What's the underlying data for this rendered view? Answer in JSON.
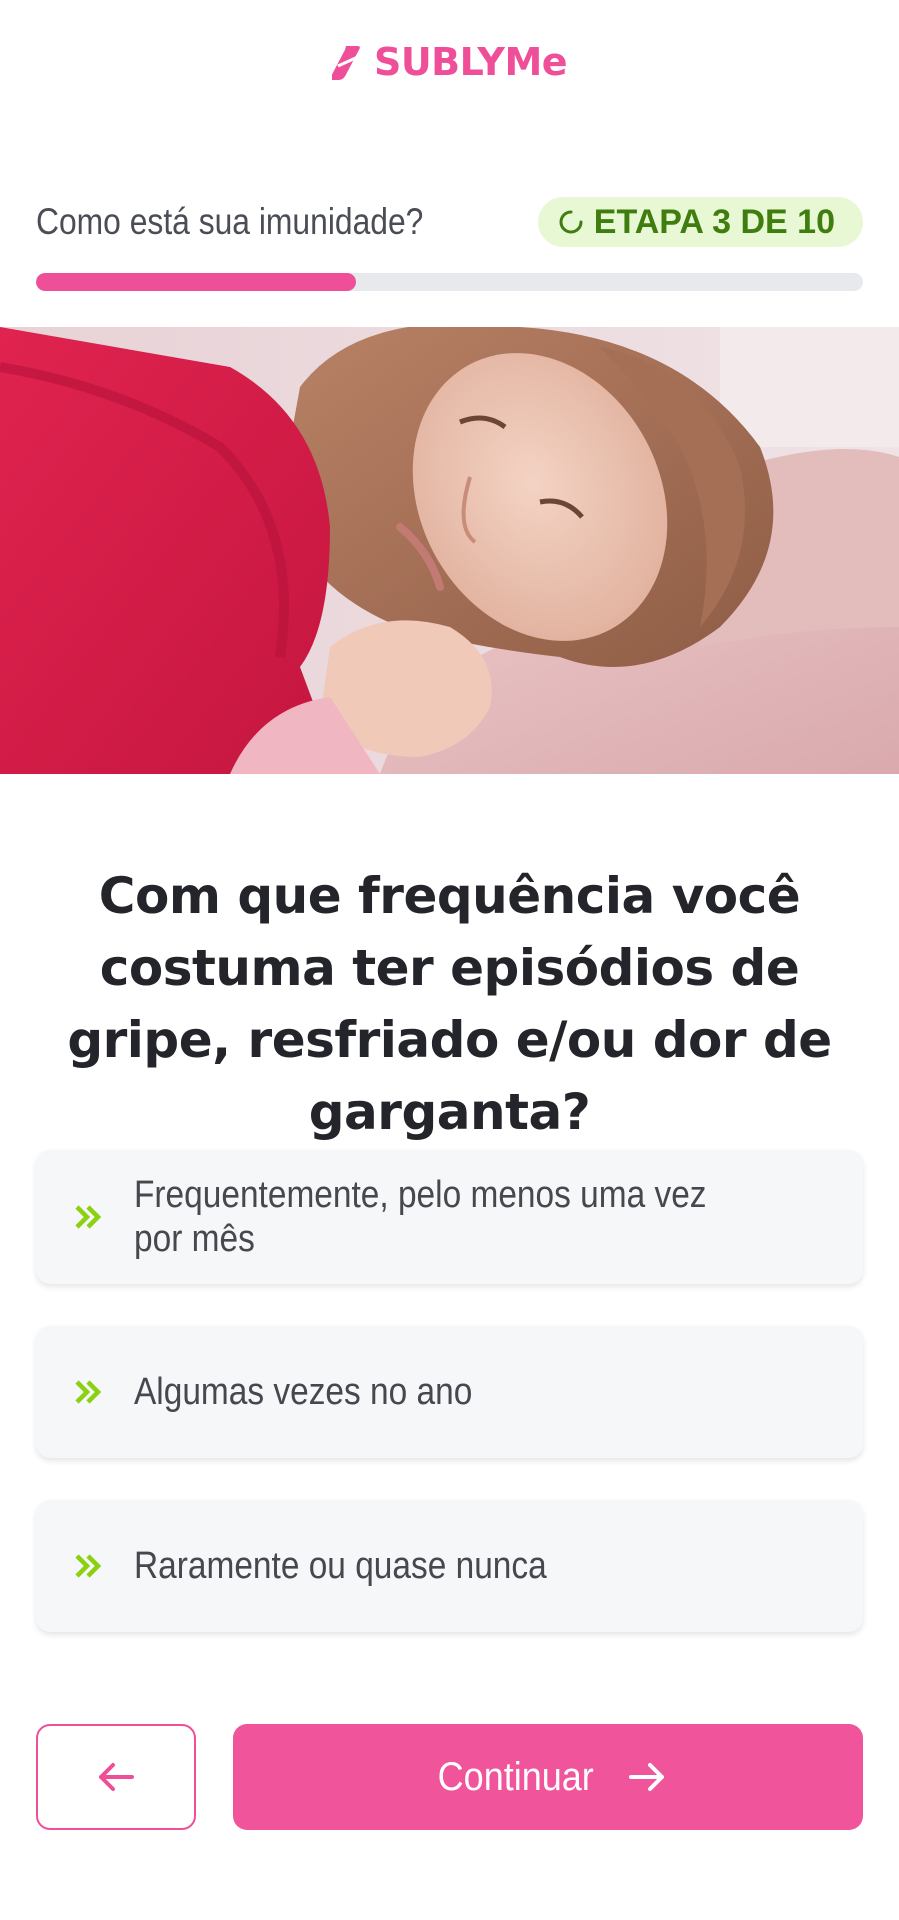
{
  "brand": {
    "name": "SUBLYMe",
    "color": "#ef4f98"
  },
  "step": {
    "question": "Como está sua imunidade?",
    "badge": "ETAPA 3 DE 10",
    "current": 3,
    "total": 10,
    "progress_fraction": 0.3875
  },
  "hero": {
    "image": "woman-sick-under-red-blanket"
  },
  "question": {
    "text": "Com que frequência você costuma ter episódios de gripe, resfriado e/ou dor de garganta?"
  },
  "options": [
    {
      "label": "Frequentemente, pelo menos uma vez por mês",
      "icon": "double-chevron-right-icon"
    },
    {
      "label": "Algumas vezes no ano",
      "icon": "double-chevron-right-icon"
    },
    {
      "label": "Raramente ou quase nunca",
      "icon": "double-chevron-right-icon"
    }
  ],
  "nav": {
    "back_icon": "arrow-left-icon",
    "continue_label": "Continuar",
    "continue_icon": "arrow-right-icon"
  },
  "colors": {
    "accent": "#ef4f98",
    "badge_bg": "#e8f8d4",
    "badge_text": "#3f7d0f",
    "chevron": "#8bd10f"
  }
}
